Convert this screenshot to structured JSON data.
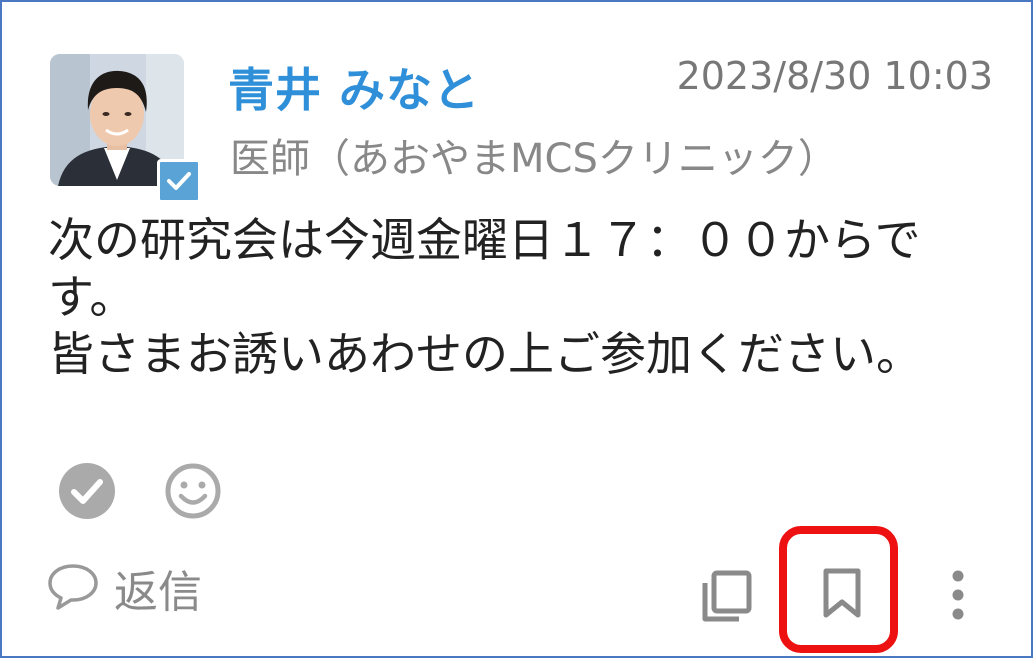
{
  "post": {
    "author_name": "青井 みなと",
    "timestamp": "2023/8/30 10:03",
    "author_role": "医師（あおやまMCSクリニック）",
    "body_lines": [
      "次の研究会は今週金曜日１７：００からで",
      "す。",
      "皆さまお誘いあわせの上ご参加ください。"
    ]
  },
  "reactions": {
    "icons": [
      "check-circle-icon",
      "smiley-icon"
    ]
  },
  "footer": {
    "reply_label": "返信",
    "icons": [
      "copy-icon",
      "bookmark-icon",
      "more-vertical-icon"
    ]
  },
  "colors": {
    "name": "#2f8fd8",
    "verified": "#5aa3d6",
    "highlight": "#ee1111",
    "border": "#4a78c2"
  }
}
